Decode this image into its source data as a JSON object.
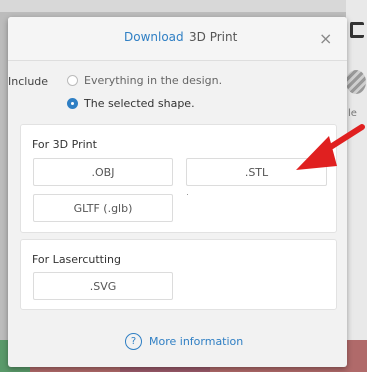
{
  "dialog": {
    "tabs": [
      {
        "label": "Download",
        "active": true
      },
      {
        "label": "3D Print",
        "active": false
      }
    ],
    "close_glyph": "×",
    "include": {
      "label": "Include",
      "options": [
        {
          "label": "Everything in the design.",
          "selected": false
        },
        {
          "label": "The selected shape.",
          "selected": true
        }
      ]
    },
    "print_section": {
      "title": "For 3D Print",
      "buttons": [
        ".OBJ",
        ".STL",
        "GLTF (.glb)"
      ]
    },
    "laser_section": {
      "title": "For Lasercutting",
      "buttons": [
        ".SVG"
      ]
    },
    "more_info": {
      "icon": "question-circle-icon",
      "glyph": "?",
      "label": "More information"
    }
  },
  "background": {
    "right_fragment": "le"
  },
  "annotation": {
    "arrow_color": "#e02020"
  },
  "colors": {
    "accent": "#2f7fc4"
  }
}
